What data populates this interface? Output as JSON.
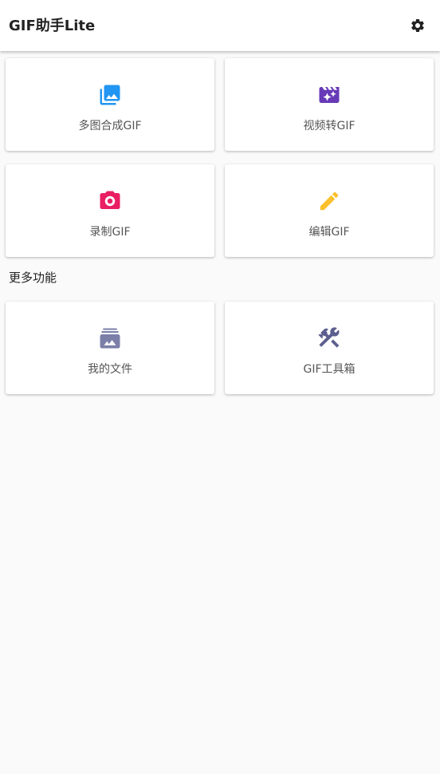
{
  "app": {
    "title": "GIF助手Lite"
  },
  "toolbar": {
    "settings_icon": "gear-icon"
  },
  "main_actions": [
    {
      "label": "多图合成GIF",
      "icon": "photo-library-icon",
      "color": "#2196f3"
    },
    {
      "label": "视频转GIF",
      "icon": "movie-filter-icon",
      "color": "#673ab7"
    },
    {
      "label": "录制GIF",
      "icon": "camera-icon",
      "color": "#e91e63"
    },
    {
      "label": "编辑GIF",
      "icon": "pencil-icon",
      "color": "#fbc02d"
    }
  ],
  "more_section": {
    "title": "更多功能",
    "items": [
      {
        "label": "我的文件",
        "icon": "photo-album-icon",
        "color": "#7b7fa8"
      },
      {
        "label": "GIF工具箱",
        "icon": "tools-icon",
        "color": "#5c5f8e"
      }
    ]
  }
}
